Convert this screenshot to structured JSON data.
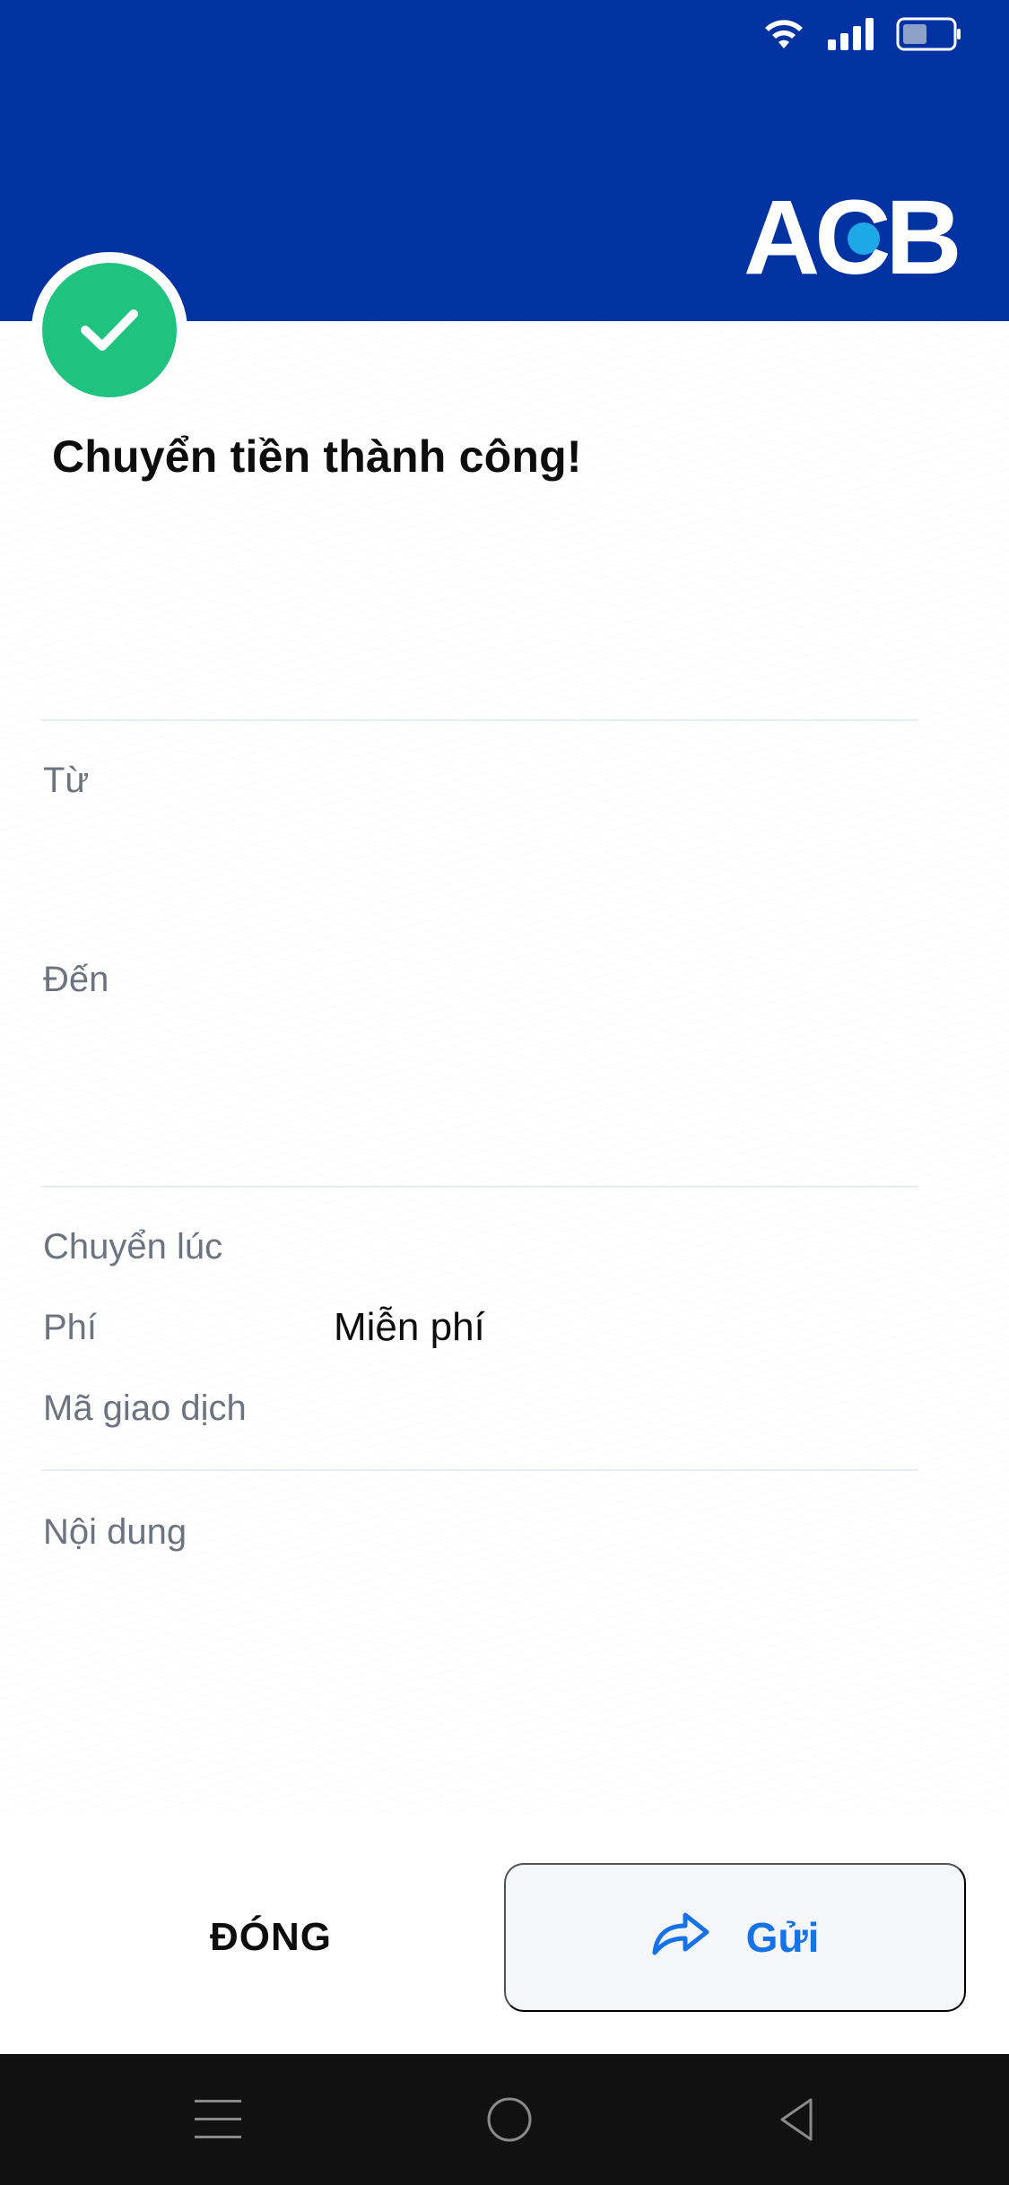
{
  "title": "Chuyển tiền thành công!",
  "brand": {
    "logo_text": "ACB",
    "color": "#0033a1",
    "accent": "#1fa8e8"
  },
  "status_bar": {
    "icons": [
      "wifi-icon",
      "signal-icon",
      "battery-icon"
    ]
  },
  "details": {
    "from_label": "Từ",
    "to_label": "Đến",
    "time_label": "Chuyển lúc",
    "fee_label": "Phí",
    "fee_value": "Miễn phí",
    "txn_label": "Mã giao dịch",
    "content_label": "Nội dung"
  },
  "actions": {
    "close_label": "ĐÓNG",
    "send_label": "Gửi",
    "send_icon": "share-arrow-icon"
  },
  "navbar": {
    "icons": [
      "menu-icon",
      "home-icon",
      "back-icon"
    ]
  },
  "colors": {
    "success": "#1fc27e",
    "link": "#1672e6"
  }
}
